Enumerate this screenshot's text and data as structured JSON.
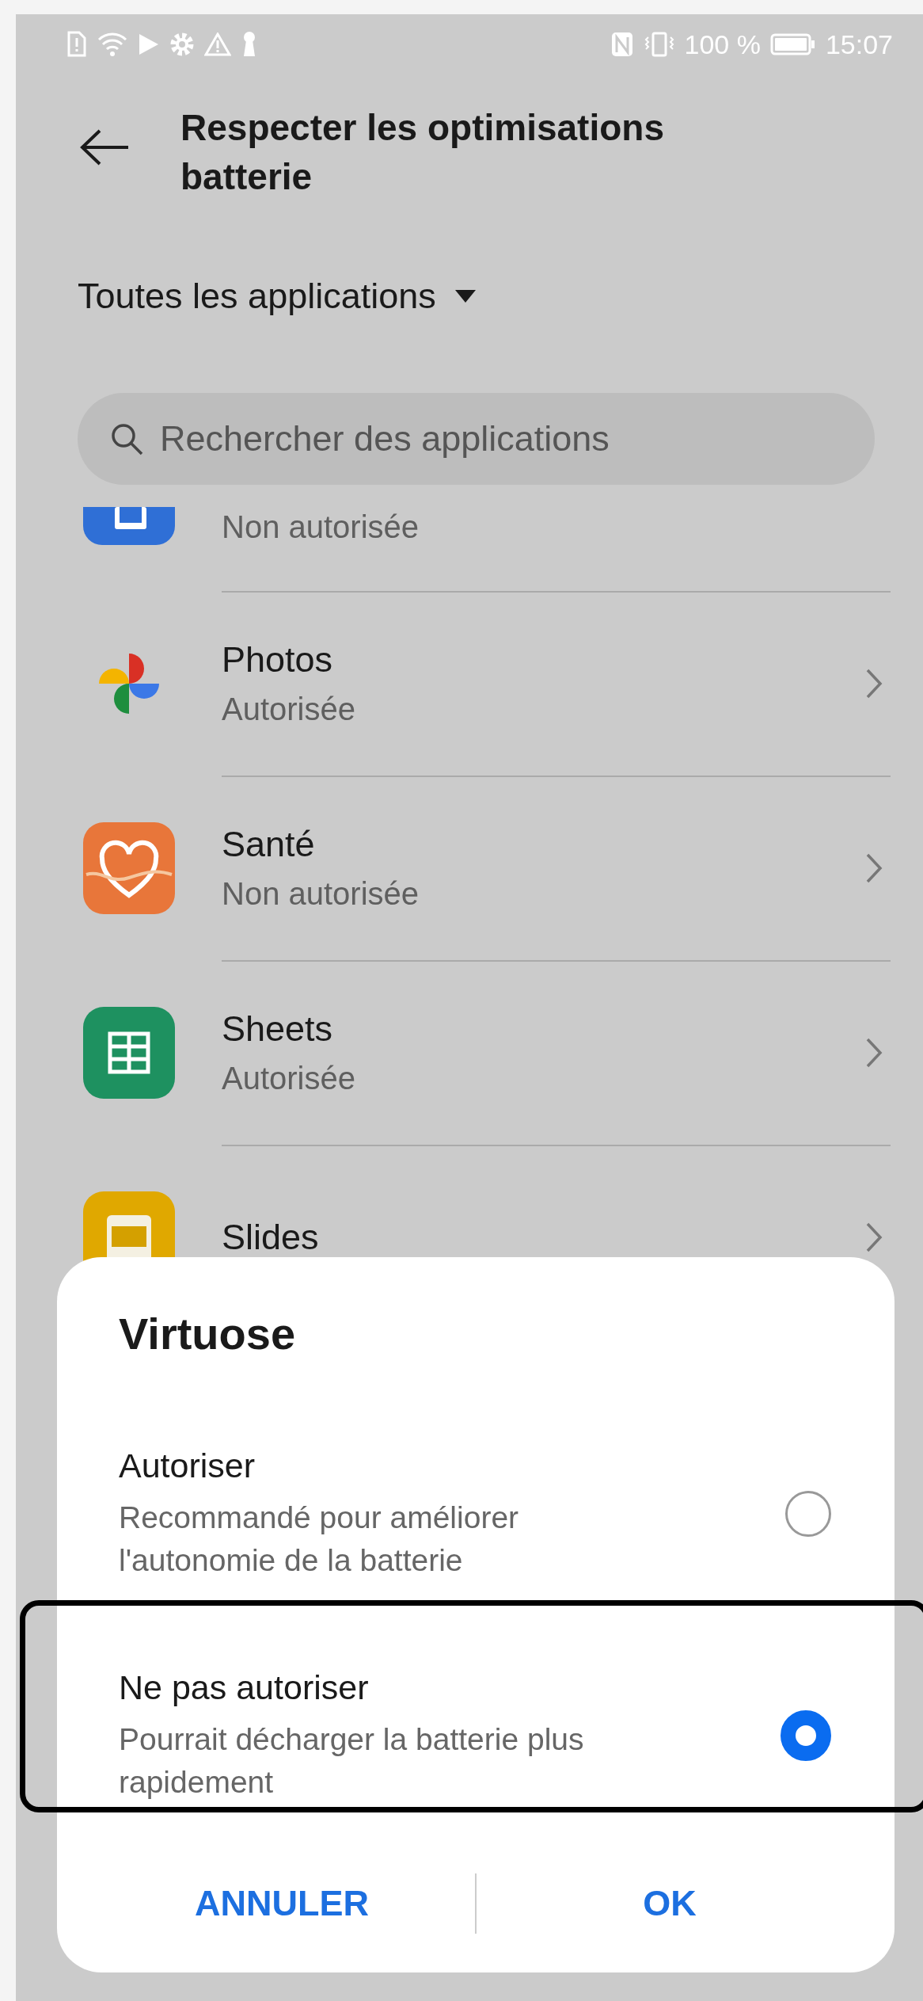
{
  "status_bar": {
    "battery_text": "100 %",
    "time": "15:07"
  },
  "header": {
    "title": "Respecter les optimisations batterie"
  },
  "filter": {
    "label": "Toutes les applications"
  },
  "search": {
    "placeholder": "Rechercher des applications"
  },
  "apps": [
    {
      "kind": "partial",
      "status": "Non autorisée"
    },
    {
      "kind": "full",
      "name": "Photos",
      "status": "Autorisée"
    },
    {
      "kind": "full",
      "name": "Santé",
      "status": "Non autorisée"
    },
    {
      "kind": "full",
      "name": "Sheets",
      "status": "Autorisée"
    },
    {
      "kind": "covered",
      "name": "Slides"
    }
  ],
  "dialog": {
    "title": "Virtuose",
    "options": [
      {
        "label": "Autoriser",
        "description": "Recommandé pour améliorer l'autonomie de la batterie",
        "selected": false,
        "highlighted": false
      },
      {
        "label": "Ne pas autoriser",
        "description": "Pourrait décharger la batterie plus rapidement",
        "selected": true,
        "highlighted": true
      }
    ],
    "buttons": [
      "ANNULER",
      "OK"
    ]
  }
}
